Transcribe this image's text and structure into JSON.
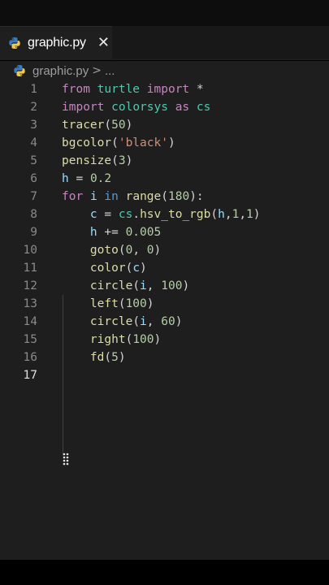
{
  "tab": {
    "filename": "graphic.py",
    "close_glyph": "✕"
  },
  "breadcrumb": {
    "filename": "graphic.py",
    "separator": ">",
    "more": "..."
  },
  "colors": {
    "background": "#1e1e1e",
    "keyword": "#c586c0",
    "builtin": "#569cd6",
    "function": "#dcdcaa",
    "module": "#4ec9b0",
    "string": "#ce9178",
    "number": "#b5cea8",
    "variable": "#9cdcfe"
  },
  "editor": {
    "active_line": 17,
    "lines": [
      {
        "n": "1",
        "tokens": [
          [
            "kw",
            "from"
          ],
          [
            "op",
            " "
          ],
          [
            "mod",
            "turtle"
          ],
          [
            "op",
            " "
          ],
          [
            "kw",
            "import"
          ],
          [
            "op",
            " *"
          ]
        ]
      },
      {
        "n": "2",
        "tokens": [
          [
            "kw",
            "import"
          ],
          [
            "op",
            " "
          ],
          [
            "mod",
            "colorsys"
          ],
          [
            "op",
            " "
          ],
          [
            "kw",
            "as"
          ],
          [
            "op",
            " "
          ],
          [
            "mod",
            "cs"
          ]
        ]
      },
      {
        "n": "3",
        "tokens": [
          [
            "fn",
            "tracer"
          ],
          [
            "op",
            "("
          ],
          [
            "num",
            "50"
          ],
          [
            "op",
            ")"
          ]
        ]
      },
      {
        "n": "4",
        "tokens": [
          [
            "fn",
            "bgcolor"
          ],
          [
            "op",
            "("
          ],
          [
            "str",
            "'black'"
          ],
          [
            "op",
            ")"
          ]
        ]
      },
      {
        "n": "5",
        "tokens": [
          [
            "fn",
            "pensize"
          ],
          [
            "op",
            "("
          ],
          [
            "num",
            "3"
          ],
          [
            "op",
            ")"
          ]
        ]
      },
      {
        "n": "6",
        "tokens": [
          [
            "var",
            "h"
          ],
          [
            "op",
            " = "
          ],
          [
            "num",
            "0.2"
          ]
        ]
      },
      {
        "n": "7",
        "tokens": [
          [
            "kw",
            "for"
          ],
          [
            "op",
            " "
          ],
          [
            "var",
            "i"
          ],
          [
            "op",
            " "
          ],
          [
            "kb",
            "in"
          ],
          [
            "op",
            " "
          ],
          [
            "fn",
            "range"
          ],
          [
            "op",
            "("
          ],
          [
            "num",
            "180"
          ],
          [
            "op",
            "):"
          ]
        ]
      },
      {
        "n": "8",
        "tokens": [
          [
            "op",
            "    "
          ],
          [
            "var",
            "c"
          ],
          [
            "op",
            " = "
          ],
          [
            "mod",
            "cs"
          ],
          [
            "op",
            "."
          ],
          [
            "fn",
            "hsv_to_rgb"
          ],
          [
            "op",
            "("
          ],
          [
            "var",
            "h"
          ],
          [
            "op",
            ","
          ],
          [
            "num",
            "1"
          ],
          [
            "op",
            ","
          ],
          [
            "num",
            "1"
          ],
          [
            "op",
            ")"
          ]
        ]
      },
      {
        "n": "9",
        "tokens": [
          [
            "op",
            "    "
          ],
          [
            "var",
            "h"
          ],
          [
            "op",
            " += "
          ],
          [
            "num",
            "0.005"
          ]
        ]
      },
      {
        "n": "10",
        "tokens": [
          [
            "op",
            "    "
          ],
          [
            "fn",
            "goto"
          ],
          [
            "op",
            "("
          ],
          [
            "num",
            "0"
          ],
          [
            "op",
            ", "
          ],
          [
            "num",
            "0"
          ],
          [
            "op",
            ")"
          ]
        ]
      },
      {
        "n": "11",
        "tokens": [
          [
            "op",
            "    "
          ],
          [
            "fn",
            "color"
          ],
          [
            "op",
            "("
          ],
          [
            "var",
            "c"
          ],
          [
            "op",
            ")"
          ]
        ]
      },
      {
        "n": "12",
        "tokens": [
          [
            "op",
            "    "
          ],
          [
            "fn",
            "circle"
          ],
          [
            "op",
            "("
          ],
          [
            "var",
            "i"
          ],
          [
            "op",
            ", "
          ],
          [
            "num",
            "100"
          ],
          [
            "op",
            ")"
          ]
        ]
      },
      {
        "n": "13",
        "tokens": [
          [
            "op",
            "    "
          ],
          [
            "fn",
            "left"
          ],
          [
            "op",
            "("
          ],
          [
            "num",
            "100"
          ],
          [
            "op",
            ")"
          ]
        ]
      },
      {
        "n": "14",
        "tokens": [
          [
            "op",
            "    "
          ],
          [
            "fn",
            "circle"
          ],
          [
            "op",
            "("
          ],
          [
            "var",
            "i"
          ],
          [
            "op",
            ", "
          ],
          [
            "num",
            "60"
          ],
          [
            "op",
            ")"
          ]
        ]
      },
      {
        "n": "15",
        "tokens": [
          [
            "op",
            "    "
          ],
          [
            "fn",
            "right"
          ],
          [
            "op",
            "("
          ],
          [
            "num",
            "100"
          ],
          [
            "op",
            ")"
          ]
        ]
      },
      {
        "n": "16",
        "tokens": [
          [
            "op",
            "    "
          ],
          [
            "fn",
            "fd"
          ],
          [
            "op",
            "("
          ],
          [
            "num",
            "5"
          ],
          [
            "op",
            ")"
          ]
        ]
      },
      {
        "n": "17",
        "tokens": []
      }
    ]
  }
}
